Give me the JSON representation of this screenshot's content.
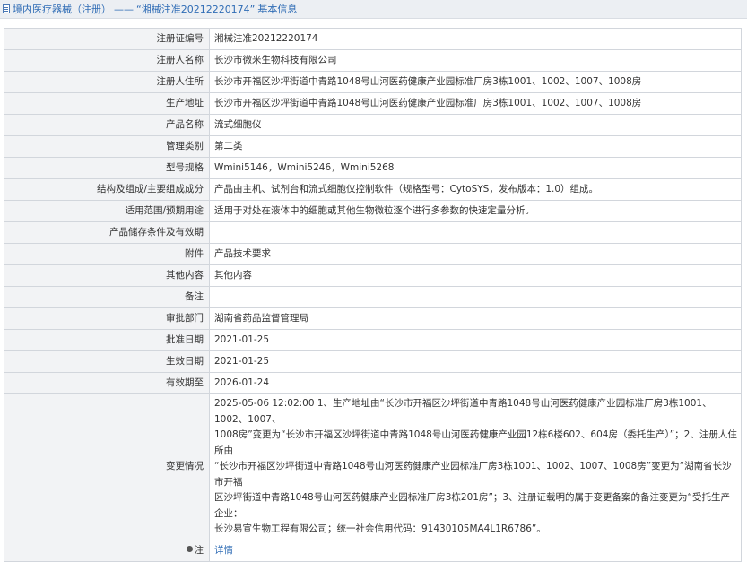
{
  "breadcrumb": {
    "root": "境内医疗器械（注册）",
    "separator": "——",
    "current": "“湘械注准20212220174”",
    "tail": "基本信息"
  },
  "rows": [
    {
      "label": "注册证编号",
      "value": "湘械注准20212220174"
    },
    {
      "label": "注册人名称",
      "value": "长沙市微米生物科技有限公司"
    },
    {
      "label": "注册人住所",
      "value": "长沙市开福区沙坪街道中青路1048号山河医药健康产业园标准厂房3栋1001、1002、1007、1008房"
    },
    {
      "label": "生产地址",
      "value": "长沙市开福区沙坪街道中青路1048号山河医药健康产业园标准厂房3栋1001、1002、1007、1008房"
    },
    {
      "label": "产品名称",
      "value": "流式细胞仪"
    },
    {
      "label": "管理类别",
      "value": "第二类"
    },
    {
      "label": "型号规格",
      "value": "Wmini5146，Wmini5246，Wmini5268"
    },
    {
      "label": "结构及组成/主要组成成分",
      "value": "产品由主机、试剂台和流式细胞仪控制软件（规格型号：CytoSYS，发布版本：1.0）组成。"
    },
    {
      "label": "适用范围/预期用途",
      "value": "适用于对处在液体中的细胞或其他生物微粒逐个进行多参数的快速定量分析。"
    },
    {
      "label": "产品储存条件及有效期",
      "value": ""
    },
    {
      "label": "附件",
      "value": "产品技术要求"
    },
    {
      "label": "其他内容",
      "value": "其他内容"
    },
    {
      "label": "备注",
      "value": ""
    },
    {
      "label": "审批部门",
      "value": "湖南省药品监督管理局"
    },
    {
      "label": "批准日期",
      "value": "2021-01-25"
    },
    {
      "label": "生效日期",
      "value": "2021-01-25"
    },
    {
      "label": "有效期至",
      "value": "2026-01-24"
    }
  ],
  "change": {
    "label": "变更情况",
    "lines": [
      "2025-05-06 12:02:00 1、生产地址由“长沙市开福区沙坪街道中青路1048号山河医药健康产业园标准厂房3栋1001、1002、1007、",
      "1008房”变更为“长沙市开福区沙坪街道中青路1048号山河医药健康产业园12栋6楼602、604房（委托生产）”；2、注册人住所由",
      "“长沙市开福区沙坪街道中青路1048号山河医药健康产业园标准厂房3栋1001、1002、1007、1008房”变更为“湖南省长沙市开福",
      "区沙坪街道中青路1048号山河医药健康产业园标准厂房3栋201房”；3、注册证载明的属于变更备案的备注变更为“受托生产企业：",
      "长沙易宣生物工程有限公司；统一社会信用代码：91430105MA4L1R6786”。"
    ]
  },
  "note": {
    "label": "注",
    "link": "详情"
  }
}
